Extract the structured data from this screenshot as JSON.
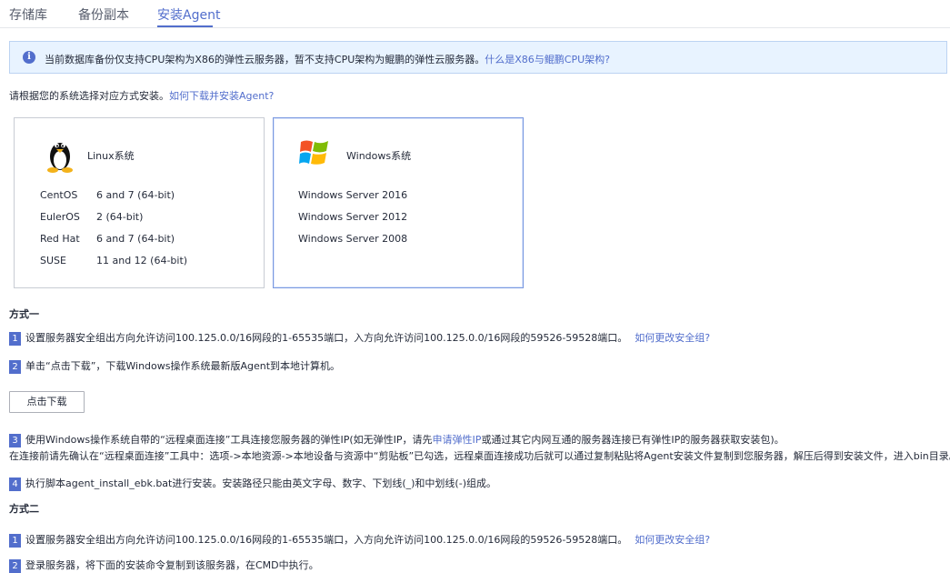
{
  "tabs": [
    "存储库",
    "备份副本",
    "安装Agent"
  ],
  "banner": {
    "text": "当前数据库备份仅支持CPU架构为X86的弹性云服务器，暂不支持CPU架构为鲲鹏的弹性云服务器。",
    "link": "什么是X86与鲲鹏CPU架构?"
  },
  "intro": {
    "text": "请根据您的系统选择对应方式安装。",
    "link": "如何下载并安装Agent?"
  },
  "linux": {
    "title": "Linux系统",
    "rows": [
      {
        "name": "CentOS",
        "ver": "6 and 7 (64-bit)"
      },
      {
        "name": "EulerOS",
        "ver": "2 (64-bit)"
      },
      {
        "name": "Red Hat",
        "ver": "6 and 7 (64-bit)"
      },
      {
        "name": "SUSE",
        "ver": "11 and 12 (64-bit)"
      }
    ]
  },
  "windows": {
    "title": "Windows系统",
    "rows": [
      "Windows Server 2016",
      "Windows Server 2012",
      "Windows Server 2008"
    ]
  },
  "method1": {
    "title": "方式一",
    "step1": {
      "num": "1",
      "text": "设置服务器安全组出方向允许访问100.125.0.0/16网段的1-65535端口，入方向允许访问100.125.0.0/16网段的59526-59528端口。",
      "link": "如何更改安全组?"
    },
    "step2": {
      "num": "2",
      "text": "单击“点击下载”，下载Windows操作系统最新版Agent到本地计算机。"
    },
    "download_label": "点击下载",
    "step3": {
      "num": "3",
      "text_a": "使用Windows操作系统自带的“远程桌面连接”工具连接您服务器的弹性IP(如无弹性IP，请先",
      "link": "申请弹性IP",
      "text_b": "或通过其它内网互通的服务器连接已有弹性IP的服务器获取安装包)。",
      "line2": "在连接前请先确认在“远程桌面连接”工具中：选项->本地资源->本地设备与资源中“剪贴板”已勾选，远程桌面连接成功后就可以通过复制粘贴将Agent安装文件复制到您服务器，解压后得到安装文件，进入bin目录。"
    },
    "step4": {
      "num": "4",
      "text": "执行脚本agent_install_ebk.bat进行安装。安装路径只能由英文字母、数字、下划线(_)和中划线(-)组成。"
    }
  },
  "method2": {
    "title": "方式二",
    "step1": {
      "num": "1",
      "text": "设置服务器安全组出方向允许访问100.125.0.0/16网段的1-65535端口，入方向允许访问100.125.0.0/16网段的59526-59528端口。",
      "link": "如何更改安全组?"
    },
    "step2": {
      "num": "2",
      "text": "登录服务器，将下面的安装命令复制到该服务器，在CMD中执行。"
    }
  },
  "colors": {
    "accent": "#526ecc",
    "banner_bg": "#e8f3ff"
  }
}
